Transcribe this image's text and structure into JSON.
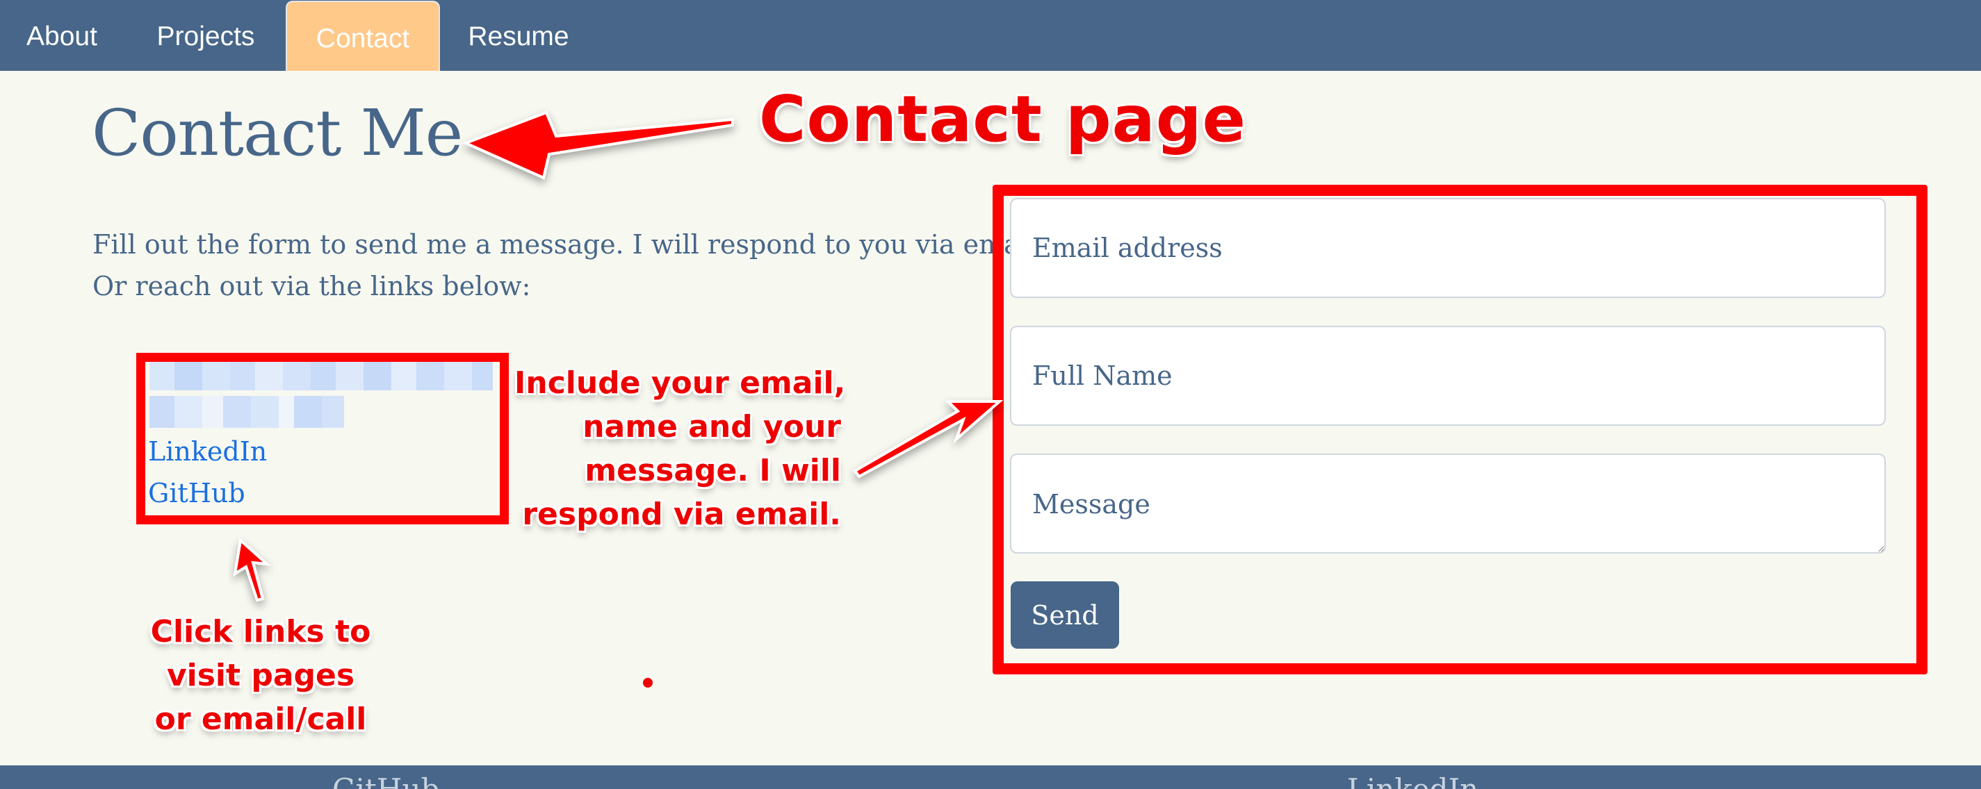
{
  "nav": {
    "items": [
      {
        "label": "About"
      },
      {
        "label": "Projects"
      },
      {
        "label": "Contact",
        "active": true
      },
      {
        "label": "Resume"
      }
    ]
  },
  "main": {
    "title": "Contact Me",
    "intro_line1": "Fill out the form to send me a message. I will respond to you via email.",
    "intro_line2": "Or reach out via the links below:",
    "links": {
      "linkedin": "LinkedIn",
      "github": "GitHub"
    }
  },
  "form": {
    "email_placeholder": "Email address",
    "name_placeholder": "Full Name",
    "message_placeholder": "Message",
    "send_label": "Send"
  },
  "annotations": {
    "title_note": "Contact page",
    "form_note_1": "Include your email,",
    "form_note_2": "name and your",
    "form_note_3": "message. I will",
    "form_note_4": "respond via email.",
    "links_note_1": "Click links to",
    "links_note_2": "visit pages",
    "links_note_3": "or email/call"
  },
  "footer": {
    "github": "GitHub",
    "linkedin": "LinkedIn"
  },
  "colors": {
    "nav_bg": "#476689",
    "active_tab": "#ffc98a",
    "page_bg": "#f7f8f0",
    "link": "#1a6fe0",
    "annotation": "#ff0000"
  }
}
